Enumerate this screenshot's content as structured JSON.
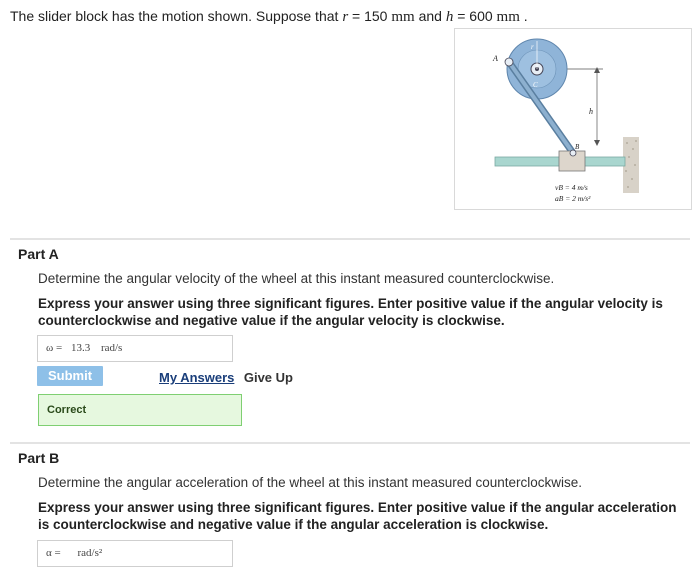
{
  "problem": {
    "text_prefix": "The slider block has the motion shown. Suppose that",
    "r_var": "r",
    "r_eq": " = 150 ",
    "r_unit": "mm",
    "and": " and ",
    "h_var": "h",
    "h_eq": " = 600 ",
    "h_unit": "mm",
    "period": " ."
  },
  "figure": {
    "label_A": "A",
    "label_r": "r",
    "label_C": "C",
    "label_h": "h",
    "label_B": "B",
    "label_vB": "vB = 4 m/s",
    "label_aB": "aB = 2 m/s²"
  },
  "part_a": {
    "title": "Part A",
    "question": "Determine the angular velocity of the wheel at this instant measured counterclockwise.",
    "instructions": "Express your answer using three significant figures. Enter positive value if the angular velocity is counterclockwise and negative value if the angular velocity is clockwise.",
    "answer_symbol": "ω =",
    "answer_value": "13.3",
    "answer_unit": "rad/s",
    "submit_label": "Submit",
    "my_answers_label": "My Answers",
    "give_up_label": "Give Up",
    "feedback": "Correct"
  },
  "part_b": {
    "title": "Part B",
    "question": "Determine the angular acceleration of the wheel at this instant measured counterclockwise.",
    "instructions": "Express your answer using three significant figures. Enter positive value if the angular acceleration is counterclockwise and negative value if the angular acceleration is clockwise.",
    "answer_symbol": "α =",
    "answer_value": "",
    "answer_unit": "rad/s²"
  },
  "colors": {
    "submit_bg": "#8ec0e8",
    "correct_border": "#7fcf72",
    "correct_bg": "#e6f8df",
    "link": "#1a3e7a"
  }
}
